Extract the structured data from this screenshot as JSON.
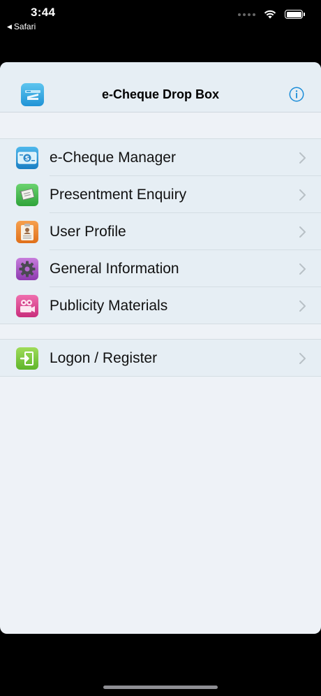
{
  "status_bar": {
    "time": "3:44",
    "back_app": "Safari",
    "icons": [
      "cellular-icon",
      "wifi-icon",
      "battery-icon"
    ]
  },
  "nav": {
    "title": "e-Cheque Drop Box",
    "app_icon": "echeque-dropbox-icon",
    "info_icon": "info-icon"
  },
  "menu": {
    "items": [
      {
        "label": "e-Cheque Manager",
        "icon": "cheque-icon"
      },
      {
        "label": "Presentment Enquiry",
        "icon": "document-scroll-icon"
      },
      {
        "label": "User Profile",
        "icon": "clipboard-profile-icon"
      },
      {
        "label": "General Information",
        "icon": "gear-icon"
      },
      {
        "label": "Publicity Materials",
        "icon": "video-camera-icon"
      }
    ]
  },
  "account": {
    "items": [
      {
        "label": "Logon / Register",
        "icon": "login-icon"
      }
    ]
  },
  "colors": {
    "accent": "#1a8cd8",
    "sheet_background": "#eef2f7",
    "row_background": "#e6eef4",
    "chevron": "#b8c0c6"
  }
}
